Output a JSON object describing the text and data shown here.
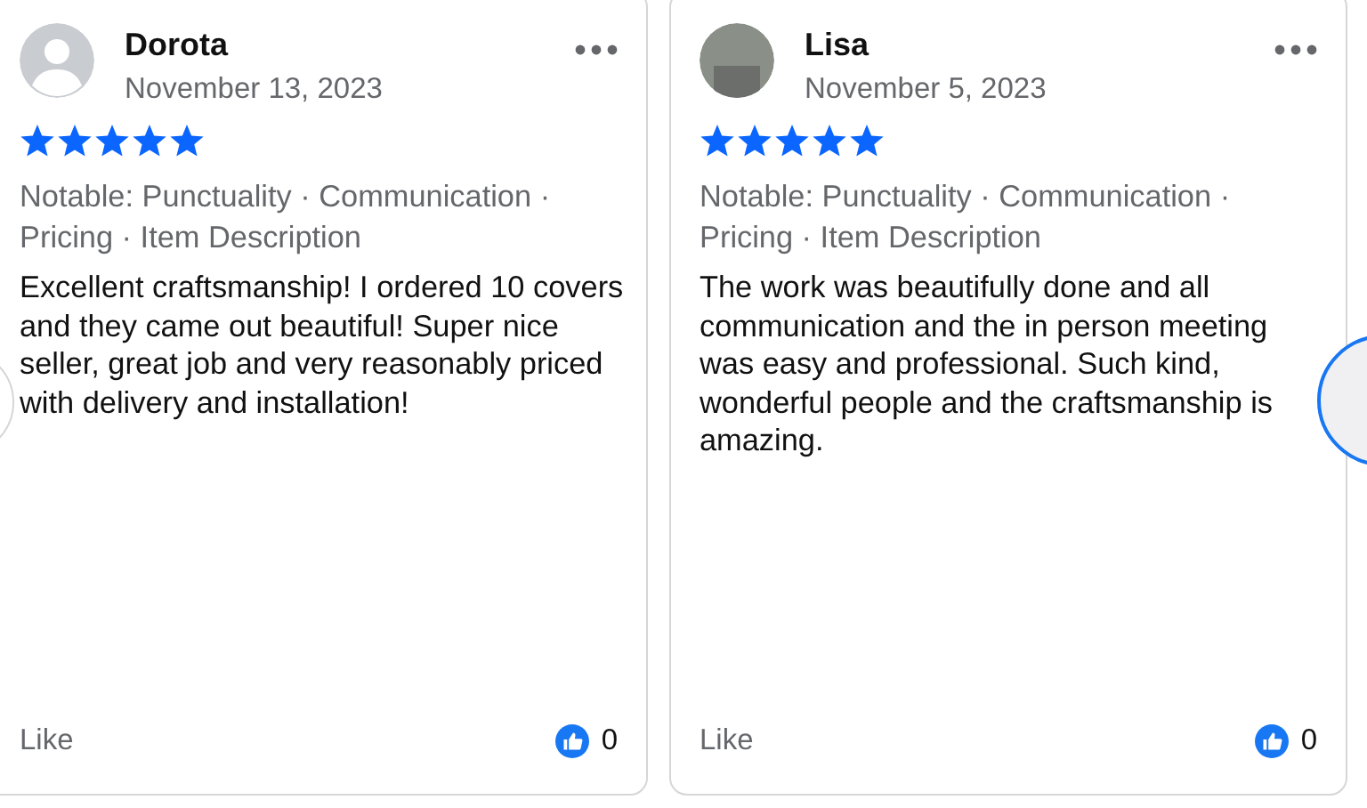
{
  "reviews": [
    {
      "name": "Dorota",
      "date": "November 13, 2023",
      "kind": "default",
      "stars": 5,
      "notable": "Notable: Punctuality · Communication · Pricing · Item Description",
      "text": "Excellent craftsmanship! I ordered 10 covers and they came out beautiful! Super nice seller, great job and very reasonably priced with delivery and installation!",
      "like": "Like",
      "like_count": "0"
    },
    {
      "name": "Lisa",
      "date": "November 5, 2023",
      "kind": "photo",
      "stars": 5,
      "notable": "Notable: Punctuality · Communication · Pricing · Item Description",
      "text": "The work was beautifully done and all communication and the in person meeting was easy and professional. Such kind, wonderful people and the craftsmanship is amazing.",
      "like": "Like",
      "like_count": "0"
    }
  ]
}
